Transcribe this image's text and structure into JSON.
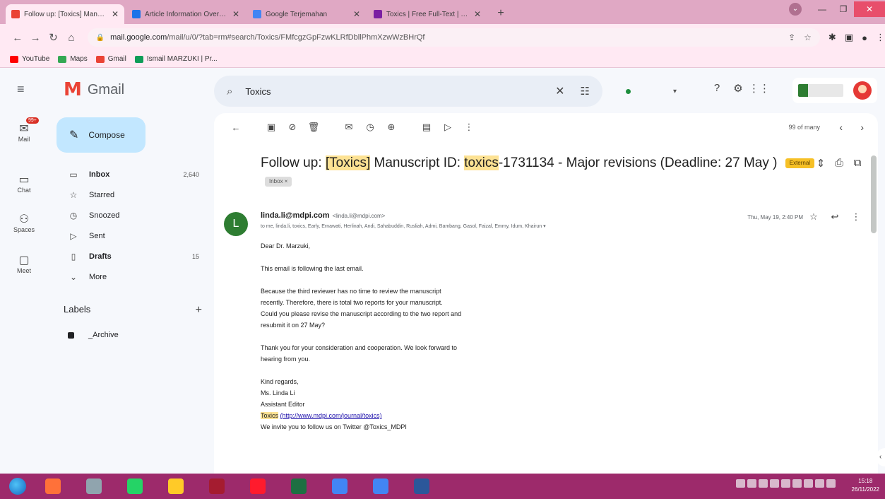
{
  "browser": {
    "tabs": [
      {
        "title": "Follow up: [Toxics] Manuscript I",
        "active": true,
        "close": "✕",
        "fav_color": "#ea4335"
      },
      {
        "title": "Article Information Overview",
        "active": false,
        "close": "✕",
        "fav_color": "#1a73e8"
      },
      {
        "title": "Google Terjemahan",
        "active": false,
        "close": "✕",
        "fav_color": "#4285f4"
      },
      {
        "title": "Toxics | Free Full-Text | Investiga",
        "active": false,
        "close": "✕",
        "fav_color": "#7b1fa2"
      }
    ],
    "new_tab": "+",
    "url_host": "mail.google.com",
    "url_path": "/mail/u/0/?tab=rm#search/Toxics/FMfcgzGpFzwKLRfDbllPhmXzwWzBHrQf",
    "bookmarks": [
      {
        "label": "YouTube",
        "color": "#ff0000"
      },
      {
        "label": "Maps",
        "color": "#34a853"
      },
      {
        "label": "Gmail",
        "color": "#ea4335"
      },
      {
        "label": "Ismail MARZUKI | Pr...",
        "color": "#0f9d58"
      }
    ]
  },
  "gmail": {
    "app_name": "Gmail",
    "logo_letter": "M",
    "rail": [
      {
        "label": "Mail",
        "icon": "✉",
        "badge": "99+"
      },
      {
        "label": "Chat",
        "icon": "▭"
      },
      {
        "label": "Spaces",
        "icon": "⚇"
      },
      {
        "label": "Meet",
        "icon": "▢"
      }
    ],
    "compose_label": "Compose",
    "nav": [
      {
        "label": "Inbox",
        "icon": "▭",
        "count": "2,640",
        "bold": true
      },
      {
        "label": "Starred",
        "icon": "☆",
        "count": "",
        "bold": false
      },
      {
        "label": "Snoozed",
        "icon": "◷",
        "count": "",
        "bold": false
      },
      {
        "label": "Sent",
        "icon": "▷",
        "count": "",
        "bold": false
      },
      {
        "label": "Drafts",
        "icon": "▯",
        "count": "15",
        "bold": true
      },
      {
        "label": "More",
        "icon": "⌄",
        "count": "",
        "bold": false
      }
    ],
    "labels_title": "Labels",
    "labels": [
      {
        "label": "_Archive"
      }
    ],
    "search": {
      "value": "Toxics"
    },
    "pager": {
      "count": "99 of many"
    },
    "subject": {
      "pre": "Follow up: ",
      "hl1": "[Toxics]",
      "mid": " Manuscript ID: ",
      "hl2": "toxics",
      "post": "-1731134 - Major revisions (Deadline: 27 May )",
      "chip_external": "External",
      "chip_inbox": "Inbox ×"
    },
    "message": {
      "avatar_letter": "L",
      "sender_name": "linda.li@mdpi.com",
      "sender_addr": "<linda.li@mdpi.com>",
      "recipients": "to me, linda.li, toxics, Early, Ernawati, Herlinah, Andi, Sahabuddin, Rusliah, Admi, Bambang, Gasol, Faizal, Emmy, Idum, Khairun ▾",
      "date": "Thu, May 19, 2:40 PM",
      "body": {
        "greeting": "Dear Dr. Marzuki,",
        "p1": "This email is following the last email.",
        "p2_lines": [
          "Because the third reviewer has no time to review the manuscript",
          "recently. Therefore, there is total two reports for your manuscript.",
          "Could you please revise the manuscript according to the two report and",
          "resubmit it on 27 May?"
        ],
        "p3_lines": [
          "Thank you for your consideration and cooperation. We look forward to",
          "hearing from you."
        ],
        "regards": "Kind regards,",
        "name": "Ms. Linda Li",
        "title": "Assistant Editor",
        "journal_hl": "Toxics",
        "journal_link": "(http://www.mdpi.com/journal/toxics)",
        "twitter": "We invite you to follow us on Twitter @Toxics_MDPI"
      }
    }
  },
  "taskbar": {
    "apps": [
      {
        "name": "firefox",
        "color": "#ff7139"
      },
      {
        "name": "network",
        "color": "#90a4ae"
      },
      {
        "name": "whatsapp",
        "color": "#25d366"
      },
      {
        "name": "explorer",
        "color": "#ffca28"
      },
      {
        "name": "mendeley",
        "color": "#a51c30"
      },
      {
        "name": "opera",
        "color": "#ff1b2d"
      },
      {
        "name": "excel",
        "color": "#1d6f42"
      },
      {
        "name": "chrome-1",
        "color": "#4285f4"
      },
      {
        "name": "chrome-2",
        "color": "#4285f4"
      },
      {
        "name": "word",
        "color": "#2b579a"
      }
    ],
    "time": "15:18",
    "date": "26/11/2022"
  }
}
